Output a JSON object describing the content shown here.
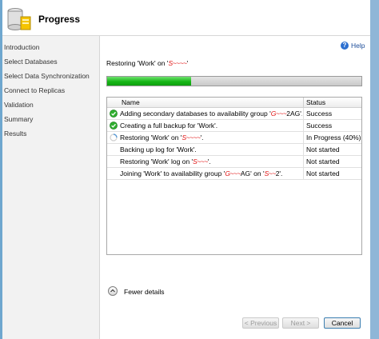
{
  "header": {
    "title": "Progress"
  },
  "nav": {
    "items": [
      "Introduction",
      "Select Databases",
      "Select Data Synchronization",
      "Connect to Replicas",
      "Validation",
      "Summary",
      "Results"
    ]
  },
  "help": {
    "label": "Help"
  },
  "progress": {
    "label_prefix": "Restoring 'Work' on '",
    "label_redacted": "S",
    "label_suffix": "'",
    "fraction": 0.33
  },
  "table": {
    "headers": {
      "name": "Name",
      "status": "Status"
    },
    "rows": [
      {
        "icon": "success-icon",
        "name_pre": "Adding secondary databases to availability group '",
        "name_red": "G",
        "name_post": "2AG'.",
        "status": "Success"
      },
      {
        "icon": "success-icon",
        "name_pre": "Creating a full backup for 'Work'.",
        "name_red": "",
        "name_post": "",
        "status": "Success"
      },
      {
        "icon": "in-progress-icon",
        "name_pre": "Restoring 'Work' on '",
        "name_red": "S",
        "name_post": "'.",
        "status": "In Progress (40%)"
      },
      {
        "icon": "",
        "name_pre": "Backing up log for 'Work'.",
        "name_red": "",
        "name_post": "",
        "status": "Not started"
      },
      {
        "icon": "",
        "name_pre": "Restoring 'Work' log on '",
        "name_red": "S",
        "name_post": "'.",
        "status": "Not started"
      },
      {
        "icon": "",
        "name_pre": "Joining 'Work' to availability group '",
        "name_red": "G",
        "name_post": "AG' on '",
        "name_red2": "S",
        "name_post2": "2'.",
        "status": "Not started"
      }
    ]
  },
  "details": {
    "label": "Fewer details"
  },
  "buttons": {
    "previous": "< Previous",
    "next": "Next >",
    "cancel": "Cancel"
  },
  "colors": {
    "accent": "#1fb81f",
    "link": "#1e4e9a",
    "redaction": "#e01010"
  }
}
